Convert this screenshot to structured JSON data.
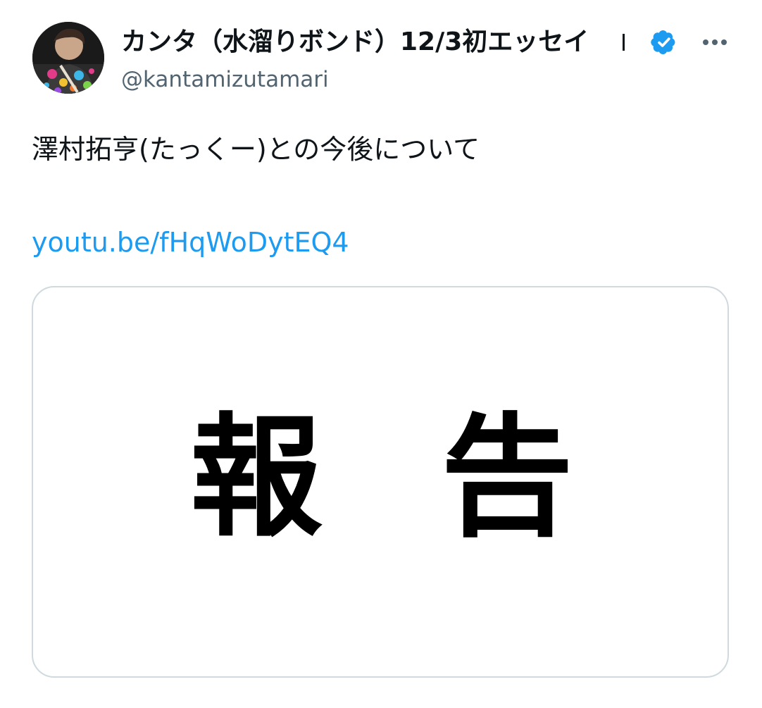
{
  "tweet": {
    "author": {
      "display_name": "カンタ（水溜りボンド）12/3初エッセイ",
      "handle": "@kantamizutamari",
      "verified": true,
      "verified_icon": "verified-badge-icon",
      "avatar_icon": "user-avatar"
    },
    "more_icon": "more-options-icon",
    "text": "澤村拓亨(たっくー)との今後について",
    "link": "youtu.be/fHqWoDytEQ4",
    "card": {
      "title": "報告"
    }
  },
  "colors": {
    "text_primary": "#0f1419",
    "text_secondary": "#536471",
    "link": "#1d9bf0",
    "verified": "#1d9bf0",
    "card_border": "#cfd9de"
  }
}
